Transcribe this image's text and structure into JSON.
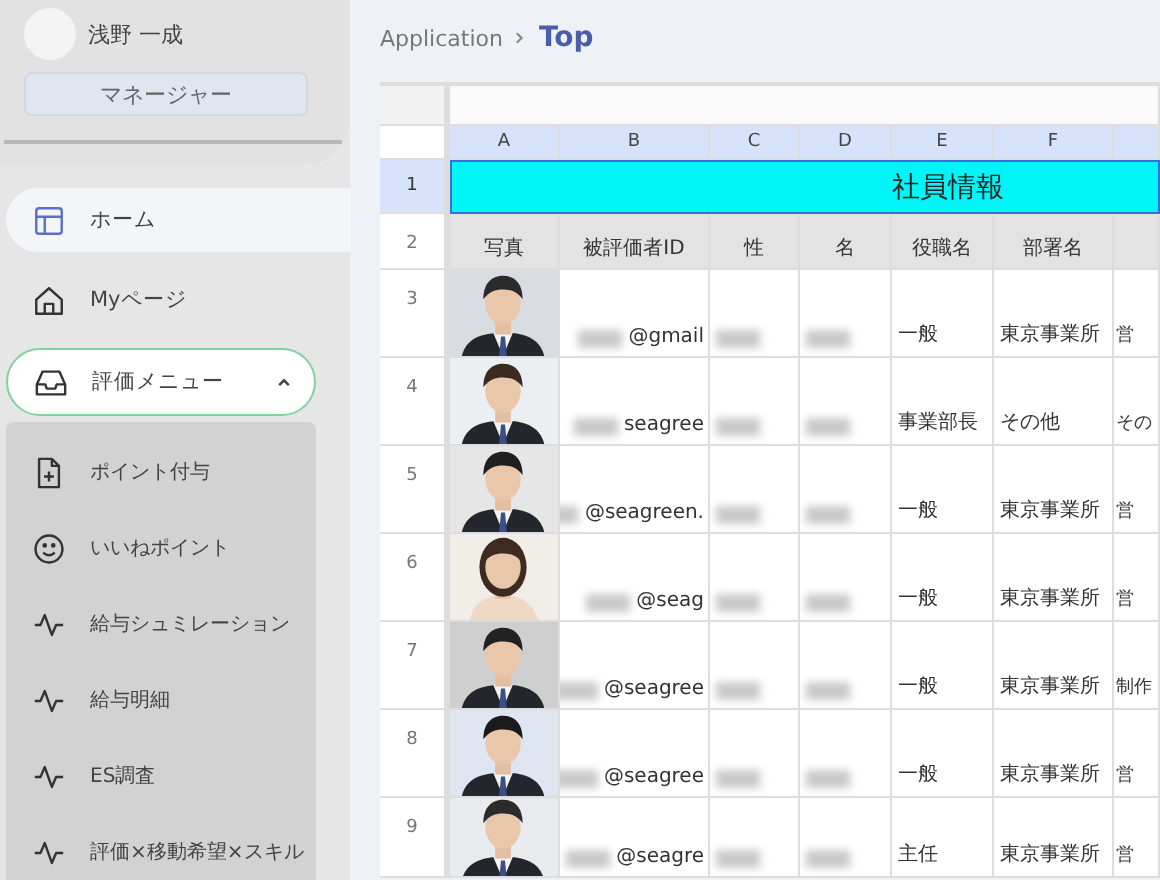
{
  "user": {
    "name": "浅野 一成",
    "role": "マネージャー"
  },
  "nav": [
    {
      "label": "ホーム",
      "selected": true
    },
    {
      "label": "Myページ",
      "selected": false
    },
    {
      "label": "評価メニュー",
      "selected": false,
      "expanded": true,
      "children": [
        {
          "label": "ポイント付与"
        },
        {
          "label": "いいねポイント"
        },
        {
          "label": "給与シュミレーション"
        },
        {
          "label": "給与明細"
        },
        {
          "label": "ES調査"
        },
        {
          "label": "評価×移動希望×スキル"
        }
      ]
    }
  ],
  "breadcrumb": [
    {
      "label": "Application",
      "selected": false
    },
    {
      "label": "Top",
      "selected": true
    }
  ],
  "sheet": {
    "columns": [
      "A",
      "B",
      "C",
      "D",
      "E",
      "F"
    ],
    "title_row": {
      "number": "1",
      "title": "社員情報"
    },
    "heading_row": {
      "number": "2",
      "headings": [
        "写真",
        "被評価者ID",
        "性",
        "名",
        "役職名",
        "部署名"
      ]
    },
    "rows": [
      {
        "number": "3",
        "id": {
          "text": "@gmail",
          "redacted": true
        },
        "last_name": {
          "redacted": true
        },
        "first_name": {
          "redacted": true
        },
        "position": "一般",
        "department": "東京事業所",
        "column_g": "営"
      },
      {
        "number": "4",
        "id": {
          "text": "seagree",
          "redacted": true
        },
        "last_name": {
          "redacted": true
        },
        "first_name": {
          "redacted": true
        },
        "position": "事業部長",
        "department": "その他",
        "column_g": "その"
      },
      {
        "number": "5",
        "id": {
          "text": "@seagreen.",
          "redacted": true
        },
        "last_name": {
          "redacted": true
        },
        "first_name": {
          "redacted": true
        },
        "position": "一般",
        "department": "東京事業所",
        "column_g": "営"
      },
      {
        "number": "6",
        "id": {
          "text": "@seag",
          "redacted": true
        },
        "last_name": {
          "redacted": true
        },
        "first_name": {
          "redacted": true
        },
        "position": "一般",
        "department": "東京事業所",
        "column_g": "営"
      },
      {
        "number": "7",
        "id": {
          "text": "@seagree",
          "redacted": true
        },
        "last_name": {
          "redacted": true
        },
        "first_name": {
          "redacted": true
        },
        "position": "一般",
        "department": "東京事業所",
        "column_g": "制作"
      },
      {
        "number": "8",
        "id": {
          "text": "@seagree",
          "redacted": true
        },
        "last_name": {
          "redacted": true
        },
        "first_name": {
          "redacted": true
        },
        "position": "一般",
        "department": "東京事業所",
        "column_g": "営"
      },
      {
        "number": "9",
        "id": {
          "text": "@seagre",
          "redacted": true
        },
        "last_name": {
          "redacted": true
        },
        "first_name": {
          "redacted": true
        },
        "position": "主任",
        "department": "東京事業所",
        "column_g": "営"
      }
    ]
  }
}
